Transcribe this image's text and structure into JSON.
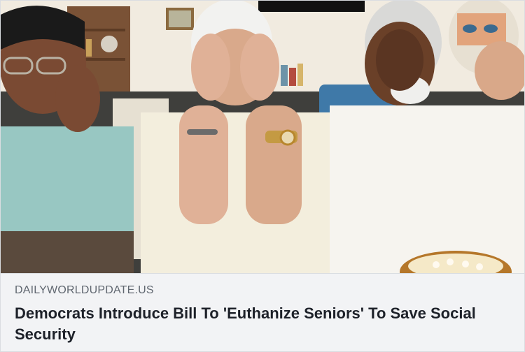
{
  "link_preview": {
    "image": {
      "icon": "photo-seniors-covering-faces"
    },
    "domain": "DAILYWORLDUPDATE.US",
    "headline": "Democrats Introduce Bill To 'Euthanize Seniors' To Save Social Security"
  },
  "colors": {
    "caption_background": "#f2f3f5",
    "domain_text": "#606770",
    "headline_text": "#1d2129",
    "border": "#dadde1"
  }
}
